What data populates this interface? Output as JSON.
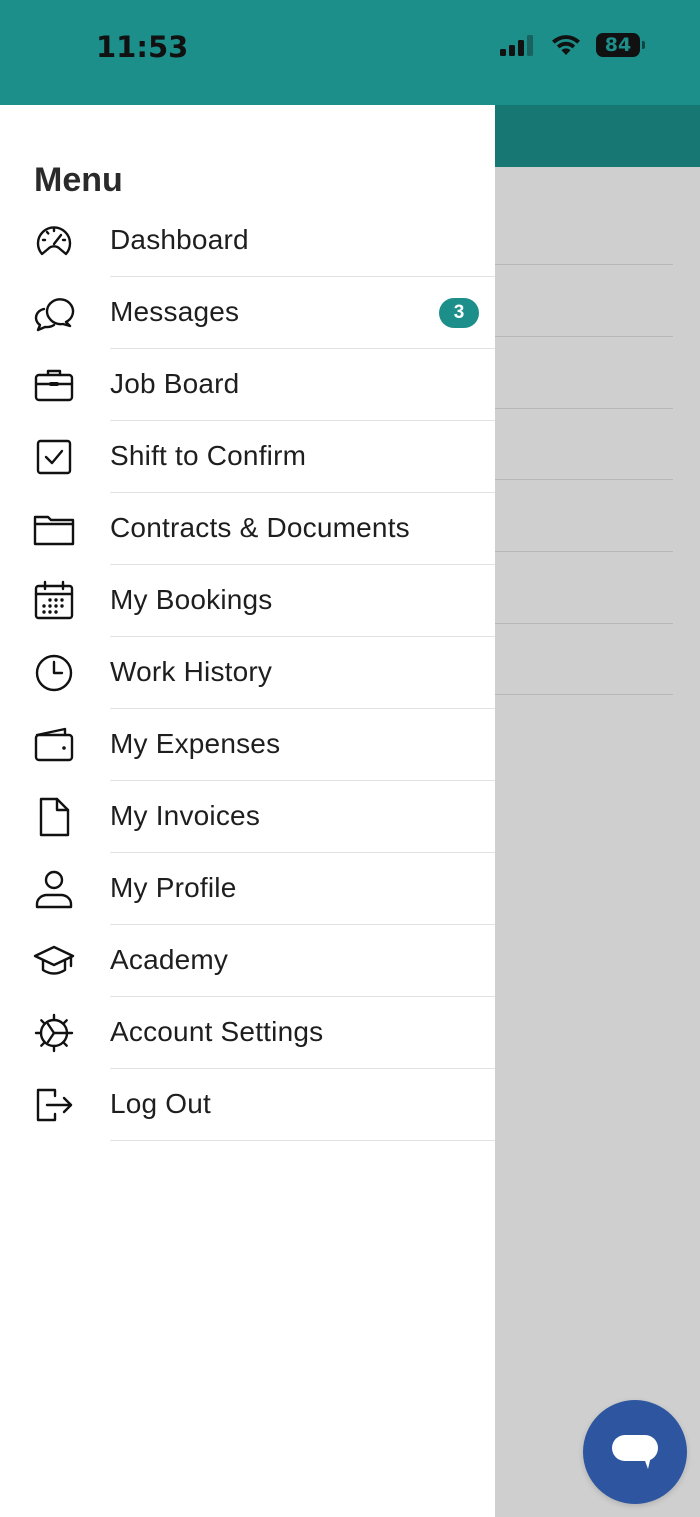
{
  "status_bar": {
    "time": "11:53",
    "battery": "84",
    "icons": [
      "cellular-signal-icon",
      "wifi-icon",
      "battery-icon"
    ]
  },
  "colors": {
    "brand_teal": "#1c8f8a",
    "dark_teal": "#177873",
    "fab_blue": "#2e56a0",
    "overlay_gray": "#cfcfcf"
  },
  "menu": {
    "title": "Menu",
    "items": [
      {
        "label": "Dashboard",
        "icon": "dashboard-gauge-icon"
      },
      {
        "label": "Messages",
        "icon": "chat-bubbles-icon",
        "badge": "3"
      },
      {
        "label": "Job Board",
        "icon": "briefcase-icon"
      },
      {
        "label": "Shift to Confirm",
        "icon": "checkbox-icon"
      },
      {
        "label": "Contracts & Documents",
        "icon": "folder-icon"
      },
      {
        "label": "My Bookings",
        "icon": "calendar-icon"
      },
      {
        "label": "Work History",
        "icon": "clock-icon"
      },
      {
        "label": "My Expenses",
        "icon": "wallet-icon"
      },
      {
        "label": "My Invoices",
        "icon": "document-icon"
      },
      {
        "label": "My Profile",
        "icon": "user-icon"
      },
      {
        "label": "Academy",
        "icon": "graduation-cap-icon"
      },
      {
        "label": "Account Settings",
        "icon": "gear-icon"
      },
      {
        "label": "Log Out",
        "icon": "logout-icon"
      }
    ]
  },
  "chat_fab": {
    "icon": "chat-icon"
  }
}
